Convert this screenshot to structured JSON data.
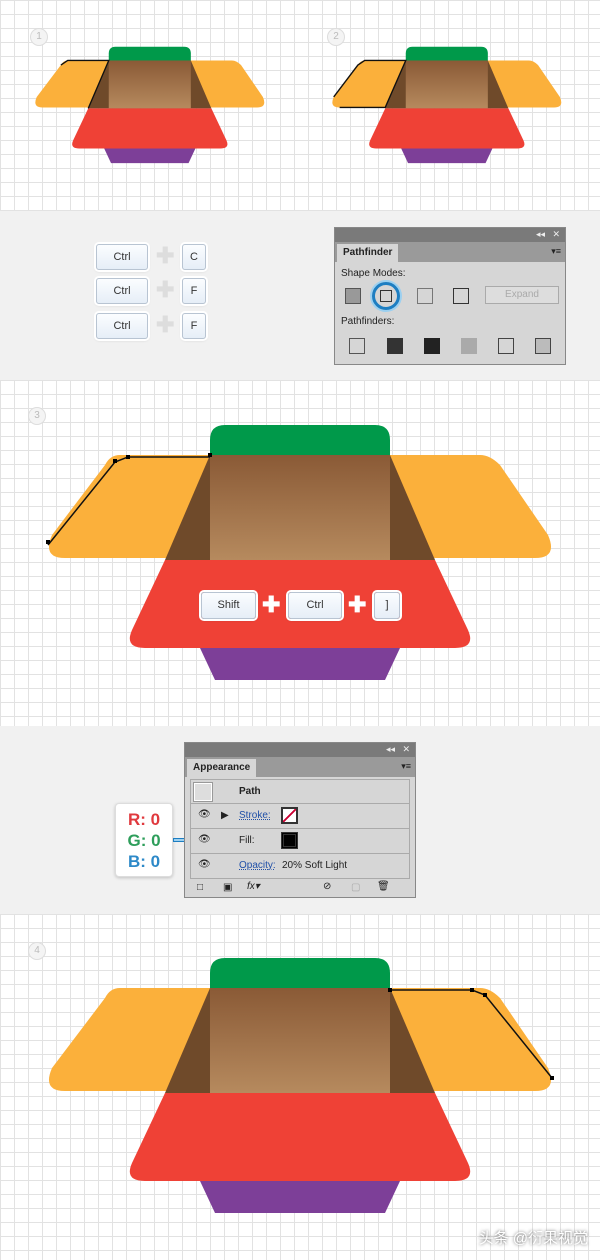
{
  "steps": [
    "1",
    "2",
    "3",
    "4"
  ],
  "keys_copy": [
    {
      "mod": "Ctrl",
      "key": "C"
    },
    {
      "mod": "Ctrl",
      "key": "F"
    },
    {
      "mod": "Ctrl",
      "key": "F"
    }
  ],
  "keys_arrange": [
    "Shift",
    "Ctrl",
    "]"
  ],
  "pathfinder": {
    "tab": "Pathfinder",
    "shape_modes": "Shape Modes:",
    "expand": "Expand",
    "pathfinders": "Pathfinders:",
    "selected_mode": "minus-front"
  },
  "appearance": {
    "tab": "Appearance",
    "path": "Path",
    "stroke": "Stroke:",
    "fill": "Fill:",
    "opacity": "Opacity:",
    "opacity_value": "20% Soft Light"
  },
  "rgb": {
    "r": "R: 0",
    "g": "G: 0",
    "b": "B: 0"
  },
  "colors": {
    "green": "#00994a",
    "orange": "#fbb03b",
    "red": "#ef4136",
    "purple": "#7d3f98",
    "brown": "#a67c52"
  },
  "watermark": "头条 @衍果视觉"
}
